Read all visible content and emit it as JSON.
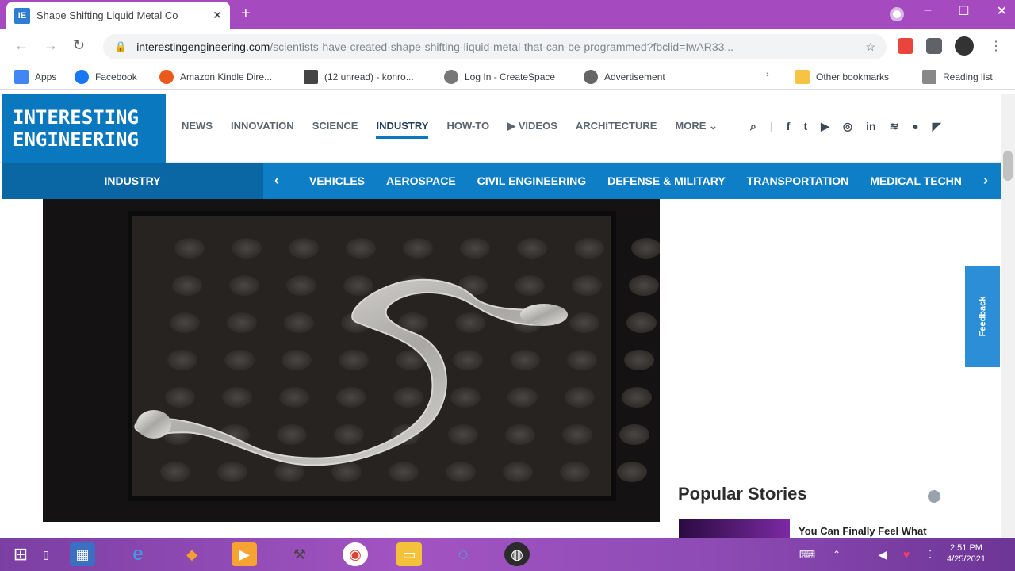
{
  "browser": {
    "tab_title": "Shape Shifting Liquid Metal Co",
    "tab_favicon": "IE",
    "new_tab": "+",
    "close_tab": "✕",
    "url_host": "interestingengineering.com",
    "url_path": "/scientists-have-created-shape-shifting-liquid-metal-that-can-be-programmed?fbclid=IwAR33..."
  },
  "bookmarks": [
    {
      "label": "Apps"
    },
    {
      "label": "Facebook"
    },
    {
      "label": "Amazon Kindle Dire..."
    },
    {
      "label": "(12 unread) - konro..."
    },
    {
      "label": "Log In - CreateSpace"
    },
    {
      "label": "Advertisement"
    },
    {
      "label": "Other bookmarks"
    },
    {
      "label": "Reading list"
    }
  ],
  "site": {
    "logo_line1": "INTERESTING",
    "logo_line2": "ENGINEERING",
    "nav": [
      "NEWS",
      "INNOVATION",
      "SCIENCE",
      "INDUSTRY",
      "HOW-TO",
      "▶ VIDEOS",
      "ARCHITECTURE",
      "MORE ⌄"
    ],
    "active_nav": "INDUSTRY",
    "section": "INDUSTRY",
    "subcategories": [
      "VEHICLES",
      "AEROSPACE",
      "CIVIL ENGINEERING",
      "DEFENSE & MILITARY",
      "TRANSPORTATION",
      "MEDICAL TECHN"
    ],
    "feedback": "Feedback",
    "popular_title": "Popular Stories",
    "popular_headline": "You Can Finally Feel What"
  },
  "taskbar": {
    "time": "2:51 PM",
    "date": "4/25/2021"
  },
  "colors": {
    "brand_blue": "#0a78bf",
    "tabstrip_purple": "#a64bbf"
  }
}
